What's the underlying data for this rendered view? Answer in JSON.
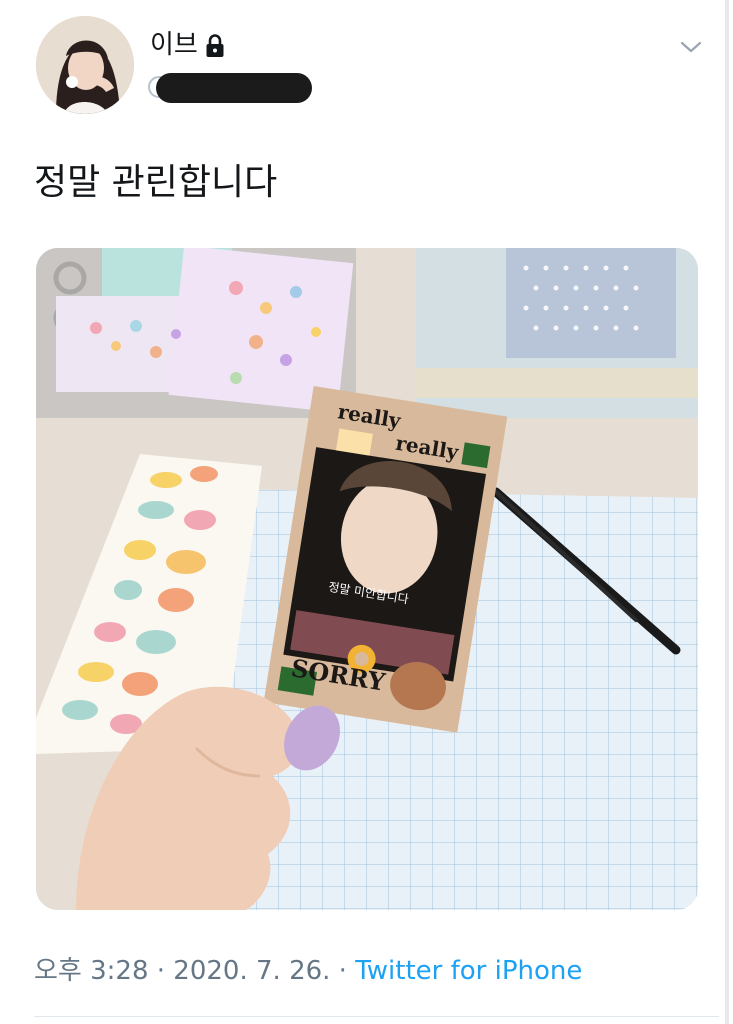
{
  "tweet": {
    "display_name": "이브",
    "protected_icon": "lock-icon",
    "handle_redacted": true,
    "menu_icon": "chevron-down-icon",
    "text": "정말 관린합니다",
    "media": {
      "card_text_top_1": "really",
      "card_text_top_2": "really",
      "card_caption": "정말 미안합니다",
      "card_text_bottom": "SORRY"
    },
    "timestamp": {
      "time": "오후 3:28",
      "separator": " · ",
      "date": "2020. 7. 26.",
      "source_separator": " · ",
      "source": "Twitter for iPhone"
    }
  },
  "colors": {
    "link": "#1da1f2",
    "secondary_text": "#657786",
    "primary_text": "#14171a"
  }
}
